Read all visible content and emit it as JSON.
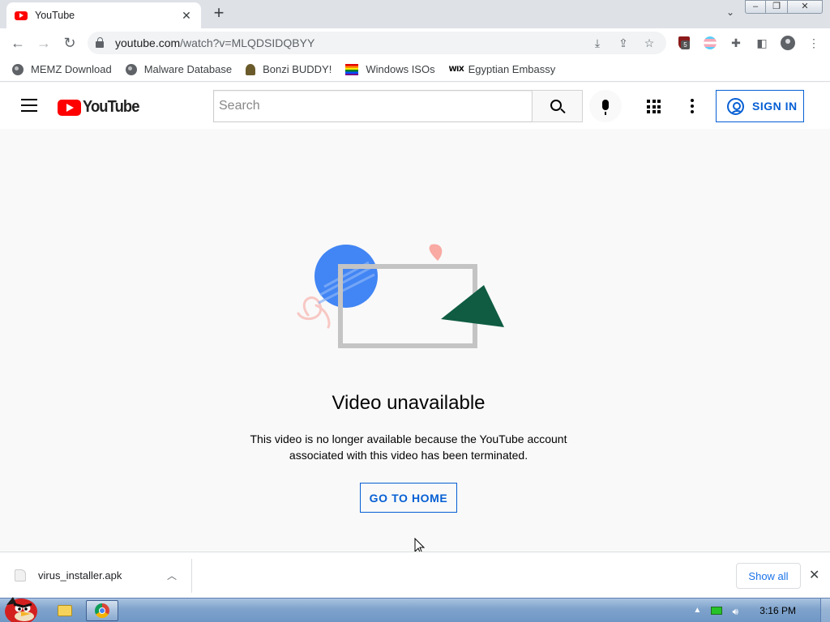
{
  "browser": {
    "tab": {
      "title": "YouTube"
    },
    "url": {
      "host": "youtube.com",
      "path": "/watch?v=MLQDSIDQBYY"
    },
    "extension_badge": "5",
    "bookmarks": [
      {
        "label": "MEMZ Download",
        "icon": "globe-icon"
      },
      {
        "label": "Malware Database",
        "icon": "globe-icon"
      },
      {
        "label": "Bonzi BUDDY!",
        "icon": "bonzi-icon"
      },
      {
        "label": "Windows ISOs",
        "icon": "rainbow-flag-icon"
      },
      {
        "label": "Egyptian Embassy",
        "icon": "wix-icon"
      }
    ],
    "wix_label": "WIX"
  },
  "youtube": {
    "logo_text": "YouTube",
    "search": {
      "placeholder": "Search",
      "value": ""
    },
    "sign_in_label": "SIGN IN",
    "error": {
      "title": "Video unavailable",
      "message": "This video is no longer available because the YouTube account associated with this video has been terminated.",
      "button_label": "GO TO HOME"
    },
    "colors": {
      "brand_red": "#ff0000",
      "link_blue": "#065fd4"
    }
  },
  "downloads": {
    "file_name": "virus_installer.apk",
    "show_all_label": "Show all"
  },
  "taskbar": {
    "clock": "3:16 PM",
    "pinned_apps": [
      "windows-explorer",
      "google-chrome"
    ]
  }
}
